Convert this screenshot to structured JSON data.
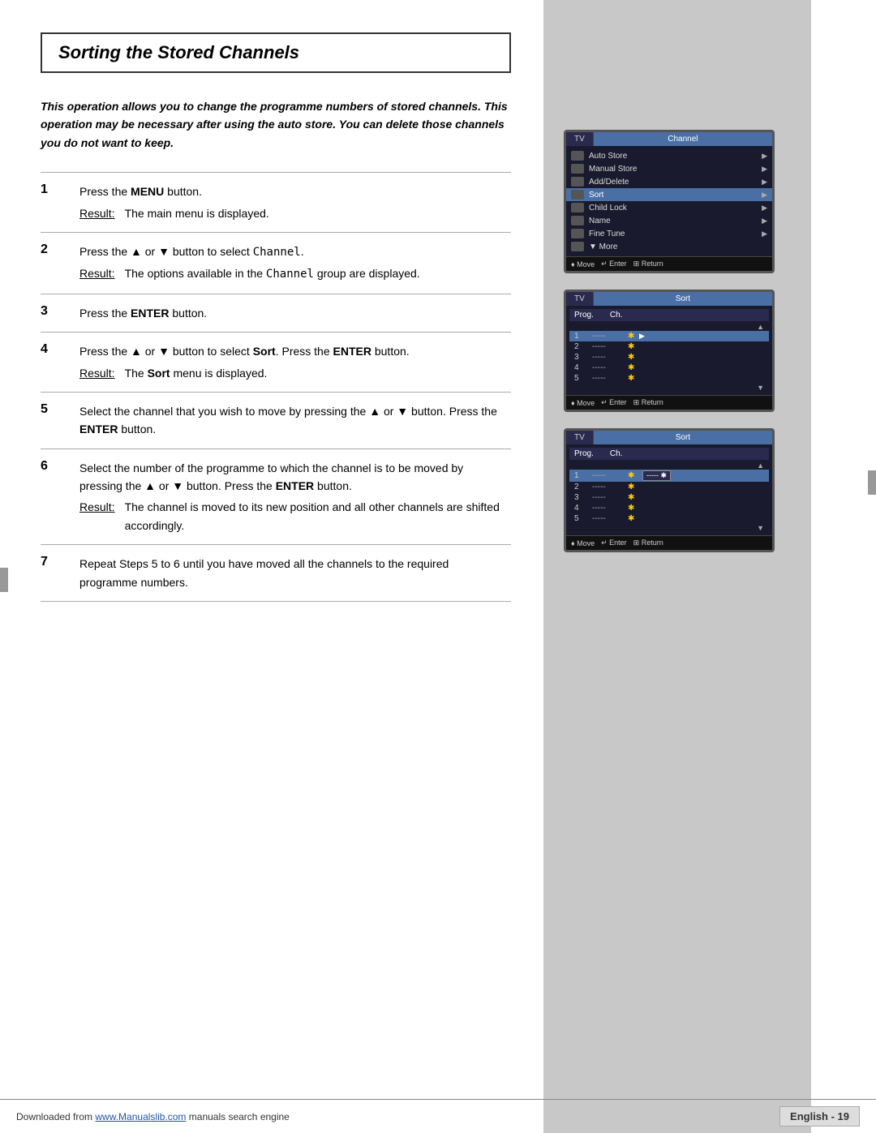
{
  "page": {
    "title": "Sorting the Stored Channels",
    "intro": "This operation allows you to change the programme numbers of stored channels. This operation may be necessary after using the auto store. You can delete those channels you do not want to keep."
  },
  "steps": [
    {
      "num": "1",
      "instruction": "Press the MENU button.",
      "result_label": "Result:",
      "result_text": "The main menu is displayed."
    },
    {
      "num": "2",
      "instruction": "Press the ▲ or ▼ button to select Channel.",
      "result_label": "Result:",
      "result_text": "The options available in the Channel group are displayed."
    },
    {
      "num": "3",
      "instruction": "Press the ENTER button.",
      "result_label": "",
      "result_text": ""
    },
    {
      "num": "4",
      "instruction": "Press the ▲ or ▼ button to select Sort. Press the ENTER button.",
      "result_label": "Result:",
      "result_text": "The Sort menu is displayed."
    },
    {
      "num": "5",
      "instruction": "Select the channel that you wish to move by pressing the ▲ or ▼ button. Press the ENTER button.",
      "result_label": "",
      "result_text": ""
    },
    {
      "num": "6",
      "instruction": "Select the number of the programme to which the channel is to be moved by pressing the ▲ or ▼ button. Press the ENTER button.",
      "result_label": "Result:",
      "result_text": "The channel is moved to its new position and all other channels are shifted accordingly."
    },
    {
      "num": "7",
      "instruction": "Repeat Steps 5 to 6 until you have moved all the channels to the required programme numbers.",
      "result_label": "",
      "result_text": ""
    }
  ],
  "screens": {
    "screen1": {
      "tv_label": "TV",
      "title": "Channel",
      "menu_items": [
        {
          "text": "Auto Store",
          "has_arrow": true,
          "highlighted": false
        },
        {
          "text": "Manual Store",
          "has_arrow": true,
          "highlighted": false
        },
        {
          "text": "Add/Delete",
          "has_arrow": true,
          "highlighted": false
        },
        {
          "text": "Sort",
          "has_arrow": true,
          "highlighted": true
        },
        {
          "text": "Child Lock",
          "has_arrow": true,
          "highlighted": false
        },
        {
          "text": "Name",
          "has_arrow": true,
          "highlighted": false
        },
        {
          "text": "Fine Tune",
          "has_arrow": true,
          "highlighted": false
        },
        {
          "text": "▼ More",
          "has_arrow": false,
          "highlighted": false
        }
      ],
      "footer": [
        "♦ Move",
        "↵ Enter",
        "⊞ Return"
      ]
    },
    "screen2": {
      "tv_label": "TV",
      "title": "Sort",
      "prog_header": [
        "Prog.",
        "Ch."
      ],
      "rows": [
        {
          "num": "1",
          "dashes": "-----",
          "star": "✱",
          "highlighted": true,
          "arrow": true
        },
        {
          "num": "2",
          "dashes": "-----",
          "star": "✱",
          "highlighted": false,
          "arrow": false
        },
        {
          "num": "3",
          "dashes": "-----",
          "star": "✱",
          "highlighted": false,
          "arrow": false
        },
        {
          "num": "4",
          "dashes": "-----",
          "star": "✱",
          "highlighted": false,
          "arrow": false
        },
        {
          "num": "5",
          "dashes": "-----",
          "star": "✱",
          "highlighted": false,
          "arrow": false
        }
      ],
      "footer": [
        "♦ Move",
        "↵ Enter",
        "⊞ Return"
      ]
    },
    "screen3": {
      "tv_label": "TV",
      "title": "Sort",
      "prog_header": [
        "Prog.",
        "Ch."
      ],
      "rows": [
        {
          "num": "1",
          "dashes": "-----",
          "star": "✱",
          "highlighted": true,
          "arrow": true,
          "second_col": true
        },
        {
          "num": "2",
          "dashes": "-----",
          "star": "✱",
          "highlighted": false,
          "arrow": false,
          "second_col": false
        },
        {
          "num": "3",
          "dashes": "-----",
          "star": "✱",
          "highlighted": false,
          "arrow": false,
          "second_col": false
        },
        {
          "num": "4",
          "dashes": "-----",
          "star": "✱",
          "highlighted": false,
          "arrow": false,
          "second_col": false
        },
        {
          "num": "5",
          "dashes": "-----",
          "star": "✱",
          "highlighted": false,
          "arrow": false,
          "second_col": false
        }
      ],
      "footer": [
        "♦ Move",
        "↵ Enter",
        "⊞ Return"
      ]
    }
  },
  "footer": {
    "left_text": "Downloaded from ",
    "link_text": "www.Manualslib.com",
    "link_suffix": " manuals search engine",
    "right_text": "English - 19"
  }
}
